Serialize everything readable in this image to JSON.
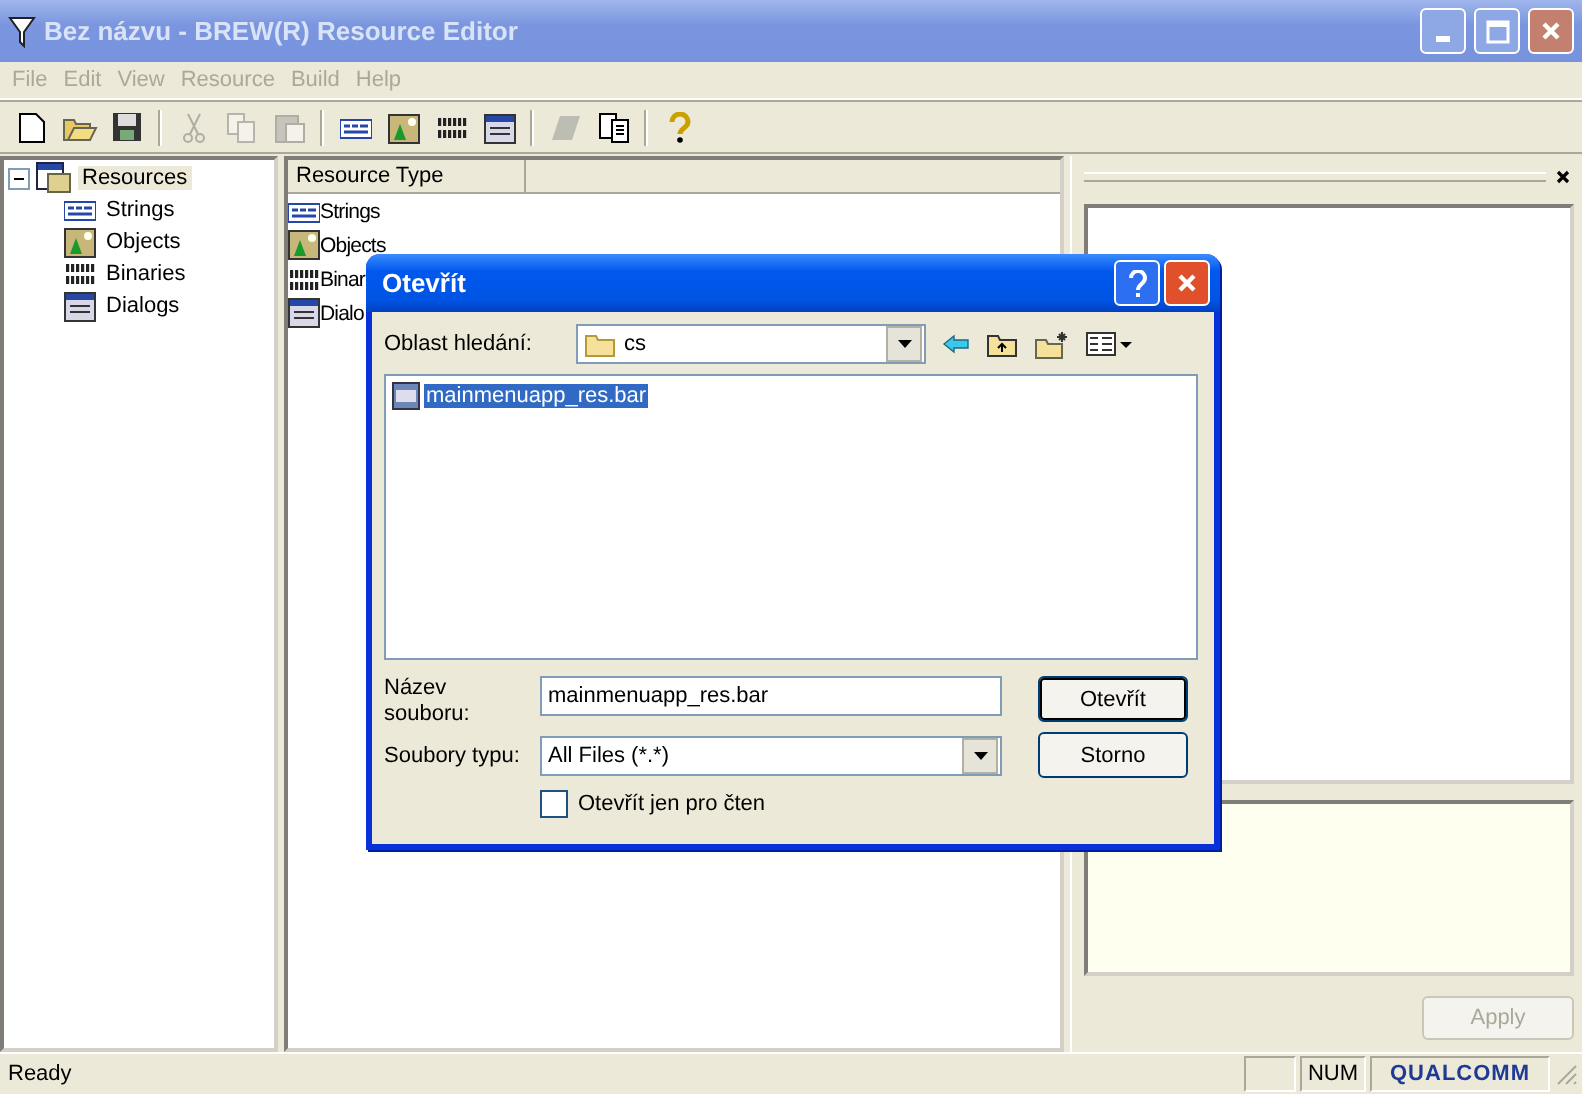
{
  "window": {
    "title": "Bez názvu - BREW(R) Resource Editor"
  },
  "menu": [
    {
      "label": "File",
      "disabled": true
    },
    {
      "label": "Edit",
      "disabled": true
    },
    {
      "label": "View",
      "disabled": true
    },
    {
      "label": "Resource",
      "disabled": true
    },
    {
      "label": "Build",
      "disabled": true
    },
    {
      "label": "Help",
      "disabled": true
    }
  ],
  "toolbar": [
    {
      "kind": "new",
      "disabled": false
    },
    {
      "kind": "open",
      "disabled": false
    },
    {
      "kind": "save",
      "disabled": false
    },
    {
      "kind": "separator"
    },
    {
      "kind": "cut",
      "disabled": true
    },
    {
      "kind": "copy",
      "disabled": true
    },
    {
      "kind": "paste",
      "disabled": true
    },
    {
      "kind": "separator"
    },
    {
      "kind": "strings",
      "disabled": false
    },
    {
      "kind": "objects",
      "disabled": false
    },
    {
      "kind": "binaries",
      "disabled": false
    },
    {
      "kind": "dialogs",
      "disabled": false
    },
    {
      "kind": "separator"
    },
    {
      "kind": "eraser",
      "disabled": true
    },
    {
      "kind": "properties",
      "disabled": false
    },
    {
      "kind": "separator"
    },
    {
      "kind": "help",
      "disabled": false
    }
  ],
  "tree": {
    "label": "Resources",
    "expanded": true,
    "selected": true,
    "children": [
      {
        "label": "Strings",
        "kind": "strings",
        "selected": false
      },
      {
        "label": "Objects",
        "kind": "objects",
        "selected": false
      },
      {
        "label": "Binaries",
        "kind": "binaries",
        "selected": false
      },
      {
        "label": "Dialogs",
        "kind": "dialogs",
        "selected": false
      }
    ]
  },
  "list": {
    "columns": [
      "Resource Type"
    ],
    "rows": [
      {
        "label": "Strings",
        "kind": "strings"
      },
      {
        "label": "Objects",
        "kind": "objects"
      },
      {
        "label": "Binar",
        "kind": "binaries"
      },
      {
        "label": "Dialo",
        "kind": "dialogs"
      }
    ]
  },
  "properties_panel": {
    "apply_button": {
      "label": "Apply",
      "disabled": true
    }
  },
  "dialog": {
    "title": "Otevřít",
    "look_in_label": "Oblast hledání:",
    "look_in_value": "cs",
    "files": [
      {
        "name": "mainmenuapp_res.bar",
        "selected": true
      }
    ],
    "file_name_label": "Název souboru:",
    "file_name_value": "mainmenuapp_res.bar",
    "file_type_label": "Soubory typu:",
    "file_type_value": "All Files (*.*)",
    "buttons": [
      {
        "label": "Otevřít",
        "default": true
      },
      {
        "label": "Storno",
        "default": false
      }
    ],
    "read_only": {
      "label": "Otevřít jen pro čten",
      "checked": false
    }
  },
  "status_bar": {
    "message": "Ready",
    "indicator": "NUM",
    "logo": "QUALCOMM"
  }
}
